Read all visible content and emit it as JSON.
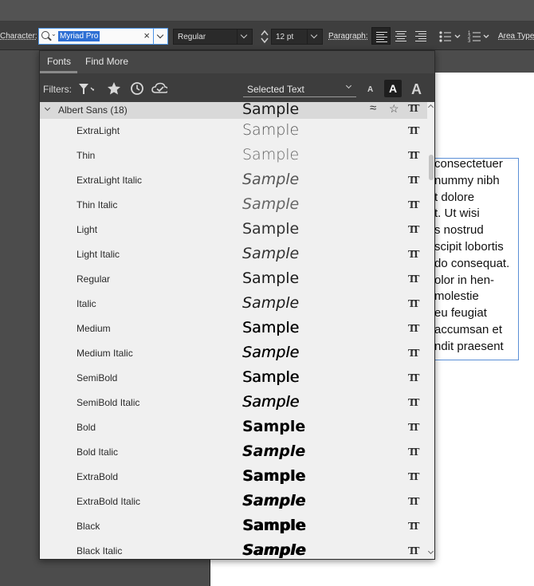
{
  "control_bar": {
    "character_label": "Character:",
    "font_search_value": "Myriad Pro",
    "font_style": "Regular",
    "font_size": "12 pt",
    "paragraph_label": "Paragraph:",
    "area_type_label": "Area Type"
  },
  "font_panel": {
    "tabs": [
      {
        "label": "Fonts"
      },
      {
        "label": "Find More"
      }
    ],
    "filters_label": "Filters:",
    "sample_mode": "Selected Text",
    "family": {
      "name": "Albert Sans (18)",
      "sample": "Sample"
    },
    "styles": [
      {
        "name": "ExtraLight",
        "sample": "Sample"
      },
      {
        "name": "Thin",
        "sample": "Sample"
      },
      {
        "name": "ExtraLight Italic",
        "sample": "Sample"
      },
      {
        "name": "Thin Italic",
        "sample": "Sample"
      },
      {
        "name": "Light",
        "sample": "Sample"
      },
      {
        "name": "Light Italic",
        "sample": "Sample"
      },
      {
        "name": "Regular",
        "sample": "Sample"
      },
      {
        "name": "Italic",
        "sample": "Sample"
      },
      {
        "name": "Medium",
        "sample": "Sample"
      },
      {
        "name": "Medium Italic",
        "sample": "Sample"
      },
      {
        "name": "SemiBold",
        "sample": "Sample"
      },
      {
        "name": "SemiBold Italic",
        "sample": "Sample"
      },
      {
        "name": "Bold",
        "sample": "Sample"
      },
      {
        "name": "Bold Italic",
        "sample": "Sample"
      },
      {
        "name": "ExtraBold",
        "sample": "Sample"
      },
      {
        "name": "ExtraBold Italic",
        "sample": "Sample"
      },
      {
        "name": "Black",
        "sample": "Sample"
      },
      {
        "name": "Black Italic",
        "sample": "Sample"
      }
    ]
  },
  "canvas": {
    "text_lines": [
      "consectetuer",
      "nummy nibh",
      "t dolore",
      "t. Ut wisi",
      "s nostrud",
      "scipit lobortis",
      "do consequat.",
      "olor in hen-",
      "molestie",
      "eu feugiat",
      "accumsan et",
      "ndit praesent"
    ]
  }
}
